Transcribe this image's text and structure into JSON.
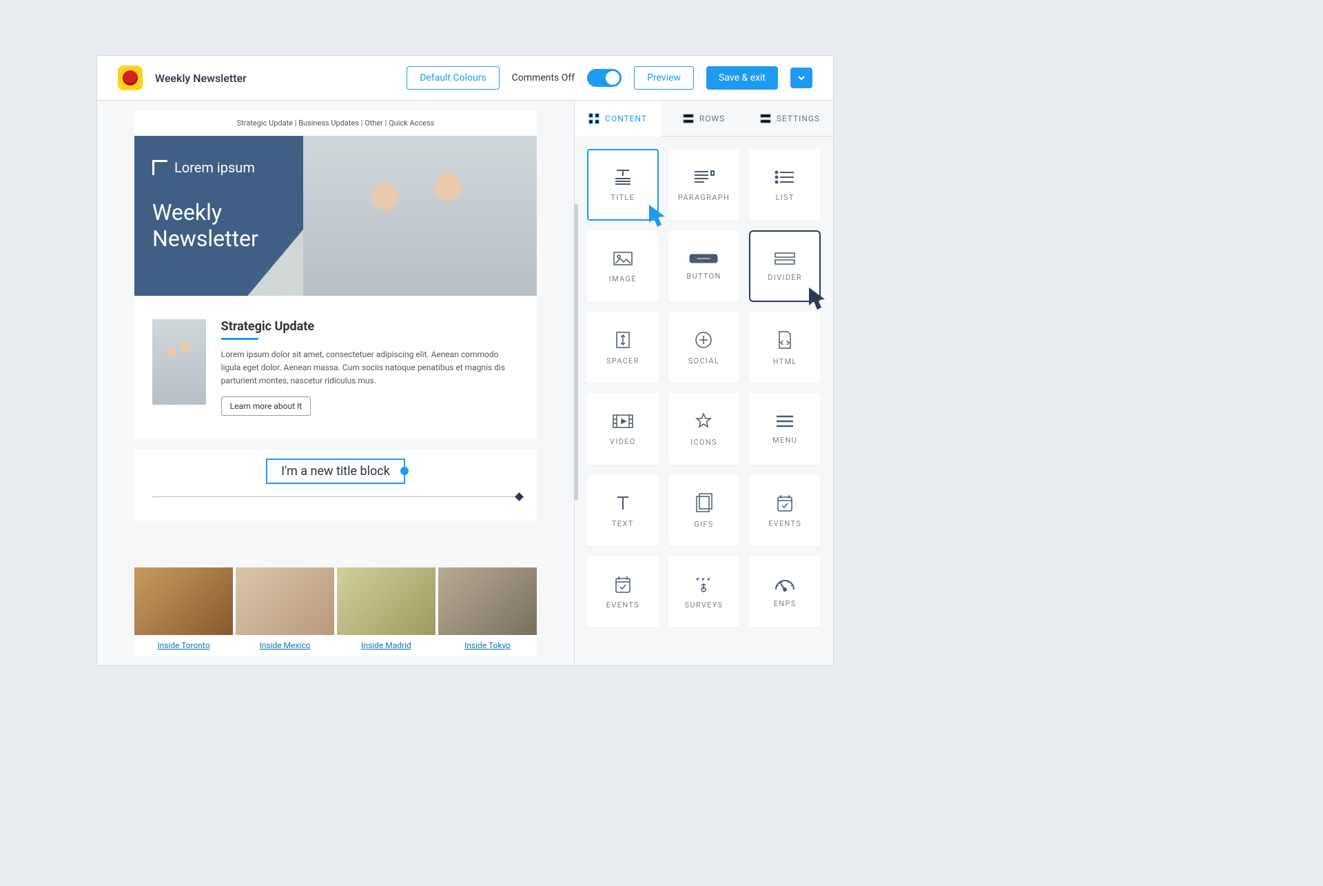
{
  "header": {
    "title": "Weekly Newsletter",
    "default_colours": "Default Colours",
    "comments": "Comments Off",
    "preview": "Preview",
    "save_exit": "Save & exit"
  },
  "tabs": {
    "content": "CONTENT",
    "rows": "ROWS",
    "settings": "SETTINGS"
  },
  "blocks": [
    {
      "id": "title",
      "label": "TITLE"
    },
    {
      "id": "paragraph",
      "label": "PARAGRAPH"
    },
    {
      "id": "list",
      "label": "LIST"
    },
    {
      "id": "image",
      "label": "IMAGE"
    },
    {
      "id": "button",
      "label": "BUTTON"
    },
    {
      "id": "divider",
      "label": "DIVIDER"
    },
    {
      "id": "spacer",
      "label": "SPACER"
    },
    {
      "id": "social",
      "label": "SOCIAL"
    },
    {
      "id": "html",
      "label": "HTML"
    },
    {
      "id": "video",
      "label": "VIDEO"
    },
    {
      "id": "icons",
      "label": "ICONS"
    },
    {
      "id": "menu",
      "label": "MENU"
    },
    {
      "id": "text",
      "label": "TEXT"
    },
    {
      "id": "gifs",
      "label": "GIFS"
    },
    {
      "id": "events",
      "label": "EVENTS"
    },
    {
      "id": "events2",
      "label": "EVENTS"
    },
    {
      "id": "surveys",
      "label": "SURVEYS"
    },
    {
      "id": "enps",
      "label": "ENPS"
    }
  ],
  "email": {
    "nav": "Strategic Update  |  Business Updates  |  Other  |  Quick Access",
    "brand": "Lorem ipsum",
    "hero_title_1": "Weekly",
    "hero_title_2": "Newsletter",
    "section_title": "Strategic Update",
    "section_body": "Lorem ipsum dolor sit amet, consectetuer adipiscing elit. Aenean commodo ligula eget dolor. Aenean massa. Cum sociis natoque penatibus et magnis dis parturient montes, nascetur ridiculus mus.",
    "learn_more": "Learn more about It",
    "new_title_block": "I'm a new title block",
    "cards": [
      {
        "caption": "Inside Toronto"
      },
      {
        "caption": "Inside Mexico"
      },
      {
        "caption": "Inside Madrid"
      },
      {
        "caption": "Inside Tokyo"
      }
    ]
  }
}
